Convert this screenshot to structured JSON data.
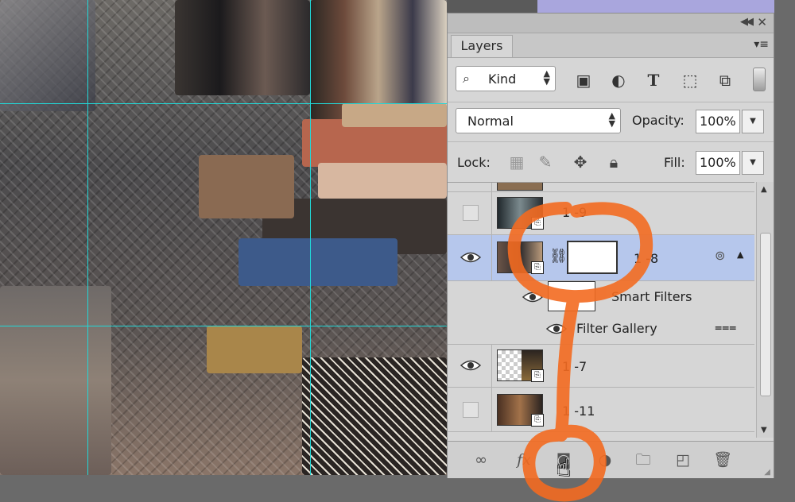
{
  "panel": {
    "tab_label": "Layers",
    "collapse_icon": "double-chevron-right-icon",
    "close_icon": "close-icon",
    "menu_icon": "panel-menu-icon"
  },
  "filter": {
    "kind_label": "Kind",
    "icons": [
      "pixel-filter-icon",
      "adjustment-filter-icon",
      "type-filter-icon",
      "shape-filter-icon",
      "smart-object-filter-icon"
    ]
  },
  "blend": {
    "mode": "Normal",
    "opacity_label": "Opacity:",
    "opacity_value": "100%",
    "fill_label": "Fill:",
    "fill_value": "100%"
  },
  "lock": {
    "label": "Lock:",
    "icons": [
      "lock-transparent-icon",
      "lock-pixels-icon",
      "lock-position-icon",
      "lock-all-icon"
    ]
  },
  "layers": [
    {
      "name": "1 -9",
      "visible": false
    },
    {
      "name": "1 -8",
      "visible": true,
      "selected": true
    },
    {
      "name": "Smart Filters",
      "sub": true
    },
    {
      "name": "Filter Gallery",
      "sub": true
    },
    {
      "name": "1 -7",
      "visible": true
    },
    {
      "name": "1 -11",
      "visible": false
    }
  ],
  "bottom_icons": [
    "link-layers-icon",
    "fx-icon",
    "add-mask-icon",
    "adjustment-layer-icon",
    "new-group-icon",
    "new-layer-icon",
    "trash-icon"
  ],
  "colors": {
    "guide": "#21d8d8",
    "selection": "#b6c7ec",
    "annotation": "#f36b21"
  }
}
